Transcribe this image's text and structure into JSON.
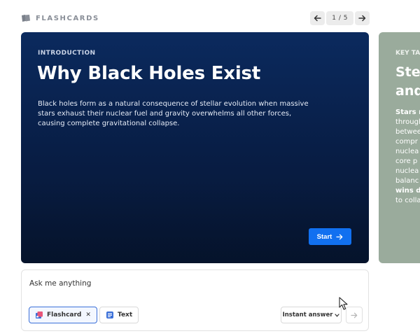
{
  "header": {
    "brand": "FLASHCARDS",
    "prev_icon": "arrow-left-icon",
    "next_icon": "arrow-right-icon",
    "page_counter": "1 / 5"
  },
  "card": {
    "eyebrow": "INTRODUCTION",
    "title": "Why Black Holes Exist",
    "body": "Black holes form as a natural consequence of stellar evolution when massive stars exhaust their nuclear fuel and gravity overwhelms all other forces, causing complete gravitational collapse.",
    "start_label": "Start",
    "background": "#0b2a5e"
  },
  "next_card": {
    "eyebrow": "KEY TA",
    "title_lines": [
      "Stel",
      "and"
    ],
    "body_lines": [
      "Stars r",
      "through",
      "betwee",
      "compr",
      "nuclea",
      "core p",
      "nuclea",
      "balanc",
      "wins d",
      "to colla"
    ],
    "background": "#9aab9c"
  },
  "ask": {
    "placeholder": "Ask me anything",
    "chips": {
      "flashcard": "Flashcard",
      "text": "Text"
    },
    "mode": "Instant answer",
    "send_icon": "arrow-right-icon"
  },
  "colors": {
    "accent": "#1170f0",
    "chip_border": "#3a6fd8"
  }
}
